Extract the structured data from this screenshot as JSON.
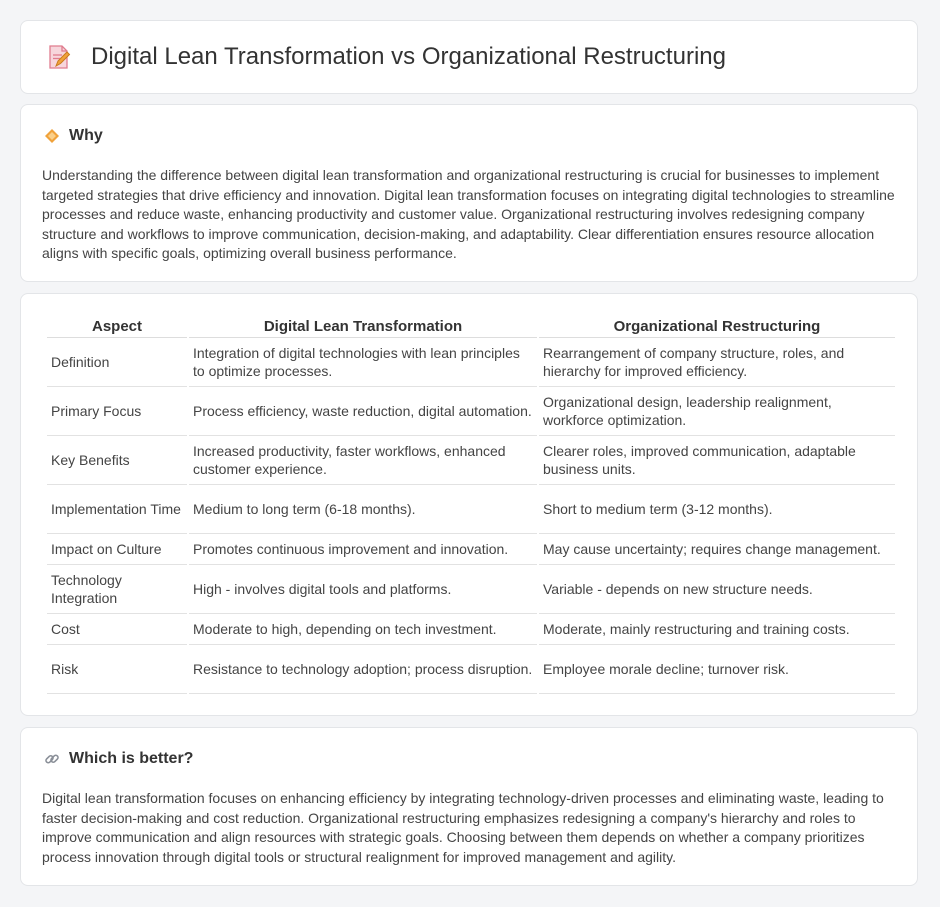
{
  "header": {
    "title": "Digital Lean Transformation vs Organizational Restructuring"
  },
  "why": {
    "heading": "Why",
    "text": "Understanding the difference between digital lean transformation and organizational restructuring is crucial for businesses to implement targeted strategies that drive efficiency and innovation. Digital lean transformation focuses on integrating digital technologies to streamline processes and reduce waste, enhancing productivity and customer value. Organizational restructuring involves redesigning company structure and workflows to improve communication, decision-making, and adaptability. Clear differentiation ensures resource allocation aligns with specific goals, optimizing overall business performance."
  },
  "table": {
    "headers": [
      "Aspect",
      "Digital Lean Transformation",
      "Organizational Restructuring"
    ],
    "rows": [
      [
        "Definition",
        "Integration of digital technologies with lean principles to optimize processes.",
        "Rearrangement of company structure, roles, and hierarchy for improved efficiency."
      ],
      [
        "Primary Focus",
        "Process efficiency, waste reduction, digital automation.",
        "Organizational design, leadership realignment, workforce optimization."
      ],
      [
        "Key Benefits",
        "Increased productivity, faster workflows, enhanced customer experience.",
        "Clearer roles, improved communication, adaptable business units."
      ],
      [
        "Implementation Time",
        "Medium to long term (6-18 months).",
        "Short to medium term (3-12 months)."
      ],
      [
        "Impact on Culture",
        "Promotes continuous improvement and innovation.",
        "May cause uncertainty; requires change management."
      ],
      [
        "Technology Integration",
        "High - involves digital tools and platforms.",
        "Variable - depends on new structure needs."
      ],
      [
        "Cost",
        "Moderate to high, depending on tech investment.",
        "Moderate, mainly restructuring and training costs."
      ],
      [
        "Risk",
        "Resistance to technology adoption; process disruption.",
        "Employee morale decline; turnover risk."
      ]
    ]
  },
  "better": {
    "heading": "Which is better?",
    "text": "Digital lean transformation focuses on enhancing efficiency by integrating technology-driven processes and eliminating waste, leading to faster decision-making and cost reduction. Organizational restructuring emphasizes redesigning a company's hierarchy and roles to improve communication and align resources with strategic goals. Choosing between them depends on whether a company prioritizes process innovation through digital tools or structural realignment for improved management and agility."
  },
  "icons": {
    "header": "document-edit-icon",
    "why": "diamond-icon",
    "better": "link-icon"
  },
  "colors": {
    "accent": "#f0a23b",
    "icon_pink": "#e8607a"
  }
}
